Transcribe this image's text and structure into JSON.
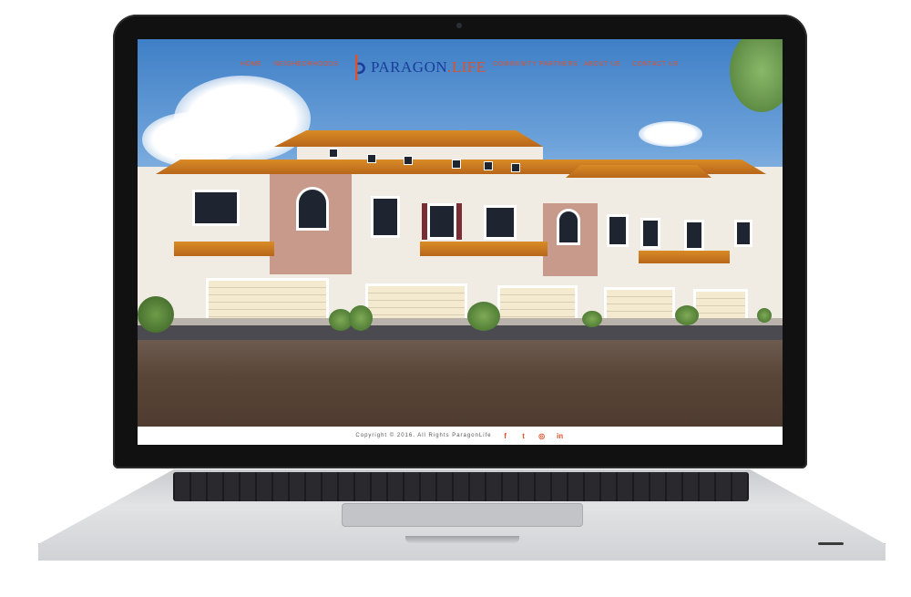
{
  "nav": {
    "left": [
      "HOME",
      "NEIGHBORHOODS"
    ],
    "right": [
      "COMMUNITY PARTNERS",
      "ABOUT US",
      "CONTACT US"
    ]
  },
  "logo": {
    "name": "PARAGON",
    "dot": ".",
    "suffix": "LIFE",
    "mark_icon": "p-logo-mark"
  },
  "footer": {
    "copyright": "Copyright © 2016. All Rights ParagonLife",
    "social": [
      {
        "icon": "facebook-icon",
        "glyph": "f"
      },
      {
        "icon": "twitter-icon",
        "glyph": "t"
      },
      {
        "icon": "instagram-icon",
        "glyph": "◎"
      },
      {
        "icon": "linkedin-icon",
        "glyph": "in"
      }
    ]
  },
  "colors": {
    "accent": "#e2502a",
    "brand": "#1a3d9a",
    "footer_bg": "#ffffff"
  }
}
